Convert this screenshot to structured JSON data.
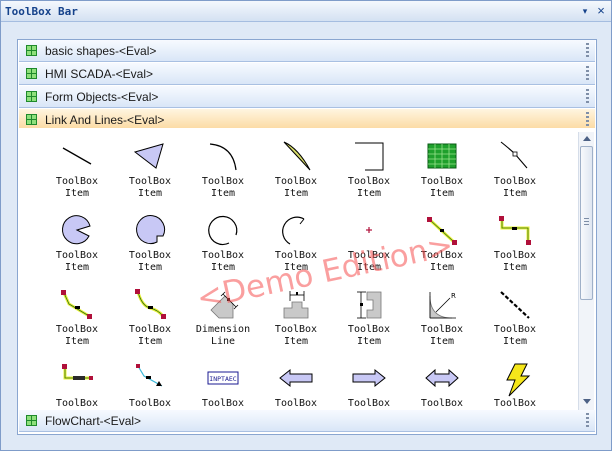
{
  "window": {
    "title": "ToolBox Bar",
    "pin_glyph": "▾",
    "close_glyph": "×"
  },
  "groups": [
    {
      "label": "basic shapes-<Eval>",
      "icon": "grid-icon"
    },
    {
      "label": "HMI SCADA-<Eval>",
      "icon": "grid-icon"
    },
    {
      "label": "Form Objects-<Eval>",
      "icon": "grid-icon"
    },
    {
      "label": "Link And Lines-<Eval>",
      "icon": "grid-icon",
      "active": true
    },
    {
      "label": "FlowChart-<Eval>",
      "icon": "grid-icon"
    }
  ],
  "watermark": "<Demo Edition>",
  "items": [
    {
      "label": "ToolBox\nItem",
      "icon": "diagonal-line-icon"
    },
    {
      "label": "ToolBox\nItem",
      "icon": "quad-shape-icon"
    },
    {
      "label": "ToolBox\nItem",
      "icon": "arc-icon"
    },
    {
      "label": "ToolBox\nItem",
      "icon": "chord-icon"
    },
    {
      "label": "ToolBox\nItem",
      "icon": "corner-line-icon"
    },
    {
      "label": "ToolBox\nItem",
      "icon": "table-grid-icon"
    },
    {
      "label": "ToolBox\nItem",
      "icon": "polyline-node-icon"
    },
    {
      "label": "ToolBox\nItem",
      "icon": "pie-filled-icon"
    },
    {
      "label": "ToolBox\nItem",
      "icon": "pie-gap-icon"
    },
    {
      "label": "ToolBox\nItem",
      "icon": "open-circle-icon"
    },
    {
      "label": "ToolBox\nItem",
      "icon": "open-arc-icon"
    },
    {
      "label": "ToolBox\nItem",
      "icon": "point-icon"
    },
    {
      "label": "ToolBox\nItem",
      "icon": "connector-line-icon"
    },
    {
      "label": "ToolBox\nItem",
      "icon": "elbow-connector-icon"
    },
    {
      "label": "ToolBox\nItem",
      "icon": "bent-connector-icon"
    },
    {
      "label": "ToolBox\nItem",
      "icon": "curve-connector-icon"
    },
    {
      "label": "Dimension\nLine",
      "icon": "dimension-line-icon"
    },
    {
      "label": "ToolBox\nItem",
      "icon": "width-dimension-icon"
    },
    {
      "label": "ToolBox\nItem",
      "icon": "height-dimension-icon"
    },
    {
      "label": "ToolBox\nItem",
      "icon": "radius-dimension-icon"
    },
    {
      "label": "ToolBox\nItem",
      "icon": "dashed-line-icon"
    },
    {
      "label": "ToolBox\nItem",
      "icon": "labeled-connector-icon"
    },
    {
      "label": "ToolBox\nItem",
      "icon": "arrow-connector-icon"
    },
    {
      "label": "ToolBox\nItem",
      "icon": "label-tag-icon",
      "tag": "INPTAEC"
    },
    {
      "label": "ToolBox\nItem",
      "icon": "block-arrow-left-icon"
    },
    {
      "label": "ToolBox\nItem",
      "icon": "block-arrow-right-icon"
    },
    {
      "label": "ToolBox\nItem",
      "icon": "double-arrow-icon"
    },
    {
      "label": "ToolBox\nItem",
      "icon": "lightning-icon"
    }
  ],
  "colors": {
    "accent": "#15428b",
    "active_group": "#fbd9a0",
    "shape_fill": "#c8c8f5",
    "node_red": "#b0103a",
    "link_yellow": "#e8f03a"
  }
}
